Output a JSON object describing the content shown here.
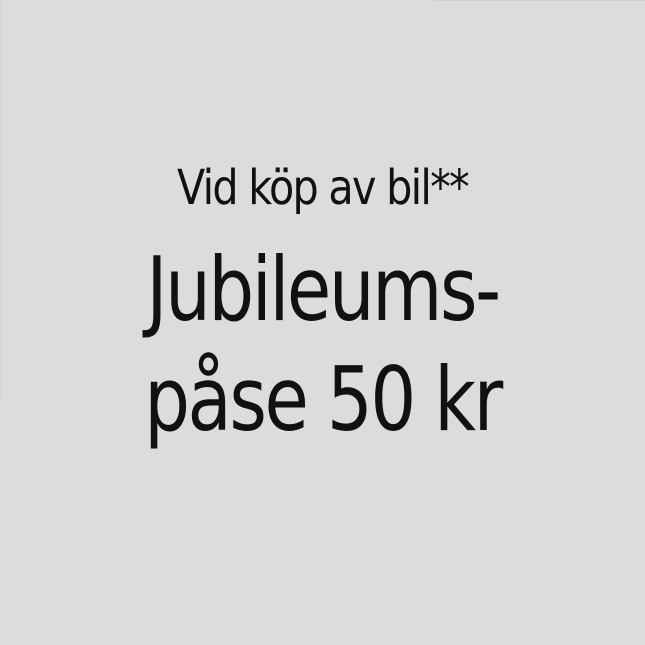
{
  "promo": {
    "line1": "Vid köp av bil**",
    "line2": "Jubileums-",
    "line3": "påse 50 kr"
  },
  "colors": {
    "background": "#dcdcdc",
    "text": "#111111"
  }
}
